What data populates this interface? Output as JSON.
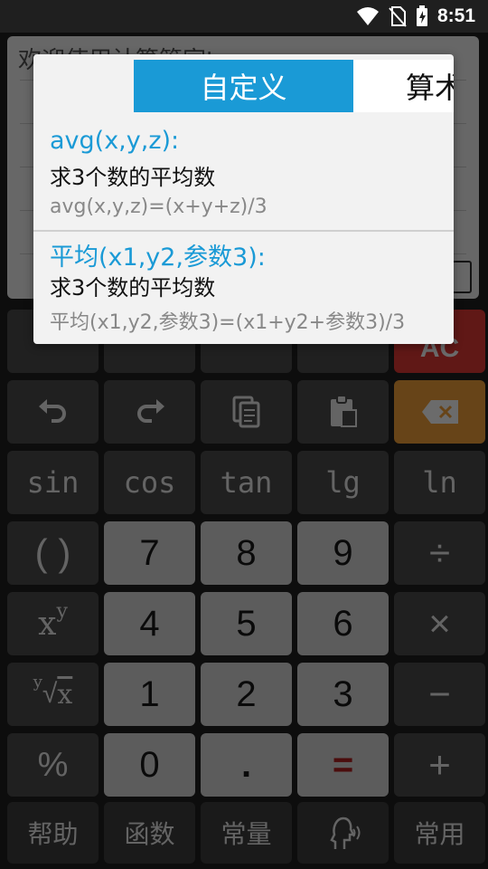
{
  "status": {
    "time": "8:51"
  },
  "screen": {
    "welcome": "欢迎使用计算管家!"
  },
  "popup": {
    "tabs": {
      "active": "自定义",
      "next": "算术"
    },
    "items": [
      {
        "title": "avg(x,y,z):",
        "desc": "求3个数的平均数",
        "formula": "avg(x,y,z)=(x+y+z)/3"
      },
      {
        "title": "平均(x1,y2,参数3):",
        "desc": "求3个数的平均数",
        "formula": "平均(x1,y2,参数3)=(x1+y2+参数3)/3"
      }
    ]
  },
  "keys": {
    "ac": "AC",
    "sin": "sin",
    "cos": "cos",
    "tan": "tan",
    "lg": "lg",
    "ln": "ln",
    "paren": "( )",
    "n7": "7",
    "n8": "8",
    "n9": "9",
    "divide": "÷",
    "power_base": "x",
    "power_exp": "y",
    "n4": "4",
    "n5": "5",
    "n6": "6",
    "multiply": "×",
    "root_idx": "y",
    "root_rad": "x",
    "n1": "1",
    "n2": "2",
    "n3": "3",
    "minus": "−",
    "percent": "%",
    "n0": "0",
    "dot": ".",
    "equals": "=",
    "plus": "+",
    "help": "帮助",
    "functions": "函数",
    "constants": "常量",
    "common": "常用"
  },
  "icons": [
    "wifi-icon",
    "no-sim-icon",
    "battery-charging-icon",
    "undo-icon",
    "redo-icon",
    "copy-icon",
    "paste-icon",
    "backspace-icon",
    "voice-icon"
  ]
}
